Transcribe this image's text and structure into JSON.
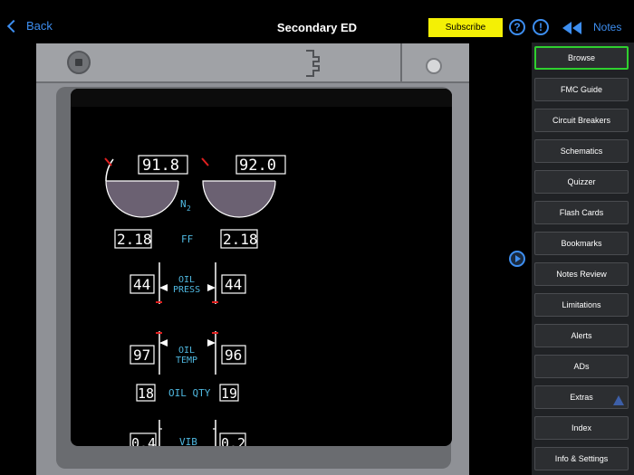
{
  "nav": {
    "back_label": "Back",
    "title": "Secondary ED",
    "subscribe_label": "Subscribe",
    "help_label": "?",
    "alert_label": "!",
    "notes_label": "Notes"
  },
  "display": {
    "n2_left": "91.8",
    "n2_right": "92.0",
    "n2_label": "N",
    "n2_sub": "2",
    "ff_left": "2.18",
    "ff_label": "FF",
    "ff_right": "2.18",
    "oil_press_left": "44",
    "oil_press_label_1": "OIL",
    "oil_press_label_2": "PRESS",
    "oil_press_right": "44",
    "oil_temp_left": "97",
    "oil_temp_label_1": "OIL",
    "oil_temp_label_2": "TEMP",
    "oil_temp_right": "96",
    "oil_qty_left": "18",
    "oil_qty_label": "OIL QTY",
    "oil_qty_right": "19",
    "vib_left": "0.4",
    "vib_label": "VIB",
    "vib_right": "0.2"
  },
  "menu": {
    "items": [
      "Browse",
      "FMC Guide",
      "Circuit Breakers",
      "Schematics",
      "Quizzer",
      "Flash Cards",
      "Bookmarks",
      "Notes Review",
      "Limitations",
      "Alerts",
      "ADs",
      "Extras",
      "Index",
      "Info & Settings"
    ],
    "active": "Browse"
  },
  "colors": {
    "accent_blue": "#3d8ef0",
    "subscribe_yellow": "#f4f005",
    "active_green": "#2fd02f",
    "label_cyan": "#4fb8e0",
    "gauge_fill": "#6b6172",
    "redline": "#e02020"
  }
}
